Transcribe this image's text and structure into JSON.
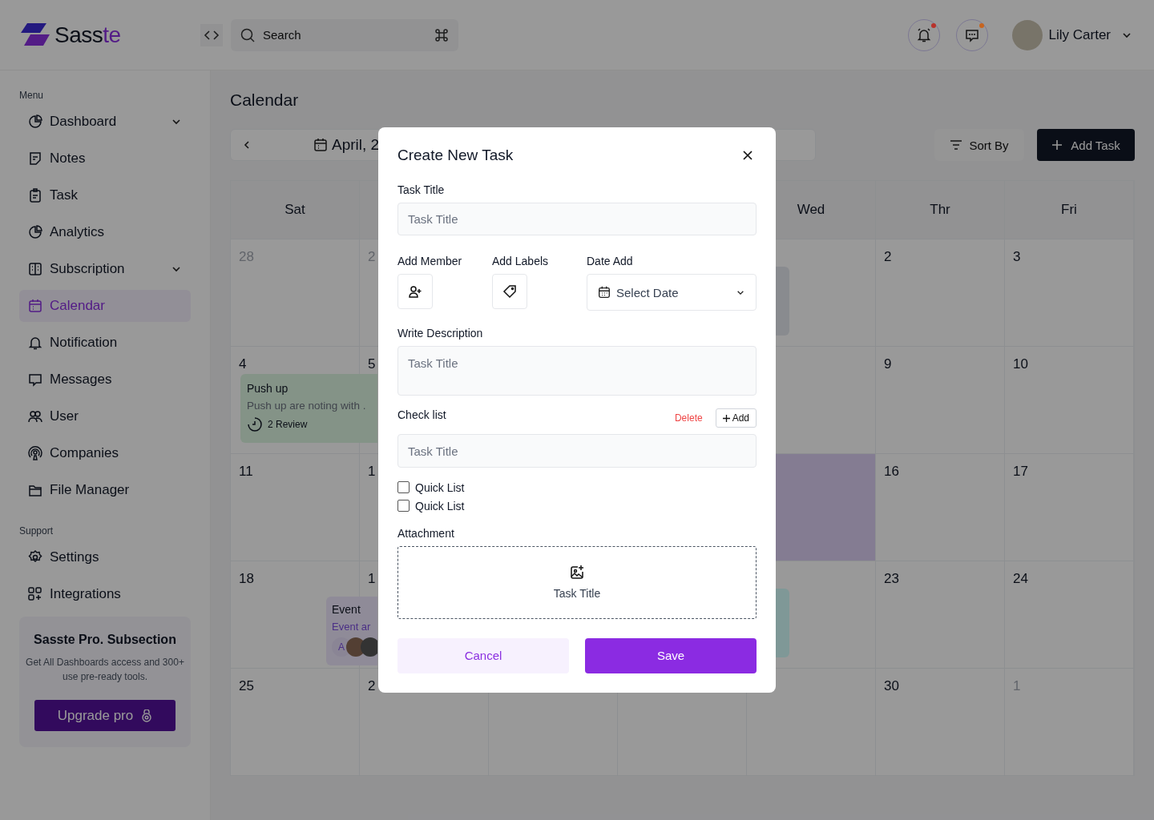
{
  "brand": {
    "name_main": "Sass",
    "name_accent": "te"
  },
  "search": {
    "placeholder": "Search"
  },
  "user": {
    "name": "Lily Carter"
  },
  "header_icons": [
    {
      "kind": "bell",
      "color": "#b8322b"
    },
    {
      "kind": "chat",
      "color": "#c7651f"
    }
  ],
  "sidebar": {
    "menu_label": "Menu",
    "items": [
      {
        "kind": "dashboard",
        "label": "Dashboard",
        "expandable": true,
        "selected": false
      },
      {
        "kind": "notes",
        "label": "Notes",
        "expandable": false,
        "selected": false
      },
      {
        "kind": "task",
        "label": "Task",
        "expandable": false,
        "selected": false
      },
      {
        "kind": "analytics",
        "label": "Analytics",
        "expandable": false,
        "selected": false
      },
      {
        "kind": "subscription",
        "label": "Subscription",
        "expandable": true,
        "selected": false
      },
      {
        "kind": "calendar",
        "label": "Calendar",
        "expandable": false,
        "selected": true
      },
      {
        "kind": "notification",
        "label": "Notification",
        "expandable": false,
        "selected": false
      },
      {
        "kind": "messages",
        "label": "Messages",
        "expandable": false,
        "selected": false
      },
      {
        "kind": "user",
        "label": "User",
        "expandable": false,
        "selected": false
      },
      {
        "kind": "companies",
        "label": "Companies",
        "expandable": false,
        "selected": false
      },
      {
        "kind": "files",
        "label": "File Manager",
        "expandable": false,
        "selected": false
      }
    ],
    "support_label": "Support",
    "support_items": [
      {
        "kind": "settings",
        "label": "Settings",
        "selected": false
      },
      {
        "kind": "integrations",
        "label": "Integrations",
        "selected": false
      }
    ],
    "promo": {
      "title": "Sasste Pro. Subsection",
      "text": "Get All Dashboards access and 300+ use pre-ready tools.",
      "button": "Upgrade pro"
    }
  },
  "page": {
    "title": "Calendar",
    "month": "April, 2",
    "sort_button": "Sort By",
    "add_button": "Add Task"
  },
  "calendar": {
    "weekdays_left": [
      "Sat"
    ],
    "weekdays_right": [
      "Wed",
      "Thr",
      "Fri"
    ],
    "weeks": [
      {
        "left": [
          {
            "day": "28",
            "muted": true,
            "highlighted": false
          },
          {
            "day": "2",
            "muted": true,
            "highlighted": false
          }
        ],
        "right": [
          {
            "highlighted": false,
            "event": {
              "kind": "blank",
              "color": "#898b8f"
            }
          },
          {
            "day": "2",
            "muted": false,
            "highlighted": false
          },
          {
            "day": "3",
            "muted": false,
            "highlighted": false
          }
        ]
      },
      {
        "left": [
          {
            "day": "4",
            "muted": false,
            "highlighted": false,
            "event": {
              "kind": "task",
              "color": "#849387",
              "title": "Push up",
              "text": "Push up are noting with .",
              "meta": "2 Review"
            }
          },
          {
            "day": "5",
            "muted": false,
            "highlighted": false
          }
        ],
        "right": [
          {
            "highlighted": false
          },
          {
            "day": "9",
            "muted": false,
            "highlighted": false
          },
          {
            "day": "10",
            "muted": false,
            "highlighted": false
          }
        ]
      },
      {
        "left": [
          {
            "day": "11",
            "muted": false,
            "highlighted": false
          },
          {
            "day": "1",
            "muted": false,
            "highlighted": false
          }
        ],
        "right": [
          {
            "highlighted": true
          },
          {
            "day": "16",
            "muted": false,
            "highlighted": false
          },
          {
            "day": "17",
            "muted": false,
            "highlighted": false
          }
        ]
      },
      {
        "left": [
          {
            "day": "18",
            "muted": false,
            "highlighted": false,
            "event": {
              "kind": "event",
              "color": "#8f8b98",
              "title": "Event",
              "text": "Event ar",
              "initial": "A"
            }
          },
          {
            "day": "1",
            "muted": false,
            "highlighted": false
          }
        ],
        "right": [
          {
            "highlighted": false,
            "event": {
              "kind": "blank",
              "color": "#7f9897"
            }
          },
          {
            "day": "23",
            "muted": false,
            "highlighted": false
          },
          {
            "day": "24",
            "muted": false,
            "highlighted": false
          }
        ]
      },
      {
        "left": [
          {
            "day": "25",
            "muted": false,
            "highlighted": false
          },
          {
            "day": "2",
            "muted": false,
            "highlighted": false
          }
        ],
        "right": [
          {
            "highlighted": false
          },
          {
            "day": "30",
            "muted": false,
            "highlighted": false
          },
          {
            "day": "1",
            "muted": true,
            "highlighted": false
          }
        ]
      }
    ]
  },
  "modal": {
    "title": "Create New Task",
    "task_title": {
      "label": "Task Title",
      "placeholder": "Task Title"
    },
    "member_label": "Add Member",
    "labels_label": "Add Labels",
    "date": {
      "label": "Date Add",
      "placeholder": "Select Date"
    },
    "description": {
      "label": "Write Description",
      "placeholder": "Task Title"
    },
    "checklist": {
      "label": "Check list",
      "delete": "Delete",
      "add": "Add",
      "placeholder": "Task Title",
      "items": [
        {
          "label": "Quick List",
          "checked": false
        },
        {
          "label": "Quick List",
          "checked": false
        }
      ]
    },
    "attachment": {
      "label": "Attachment",
      "hint": "Task Title"
    },
    "cancel": "Cancel",
    "save": "Save"
  }
}
